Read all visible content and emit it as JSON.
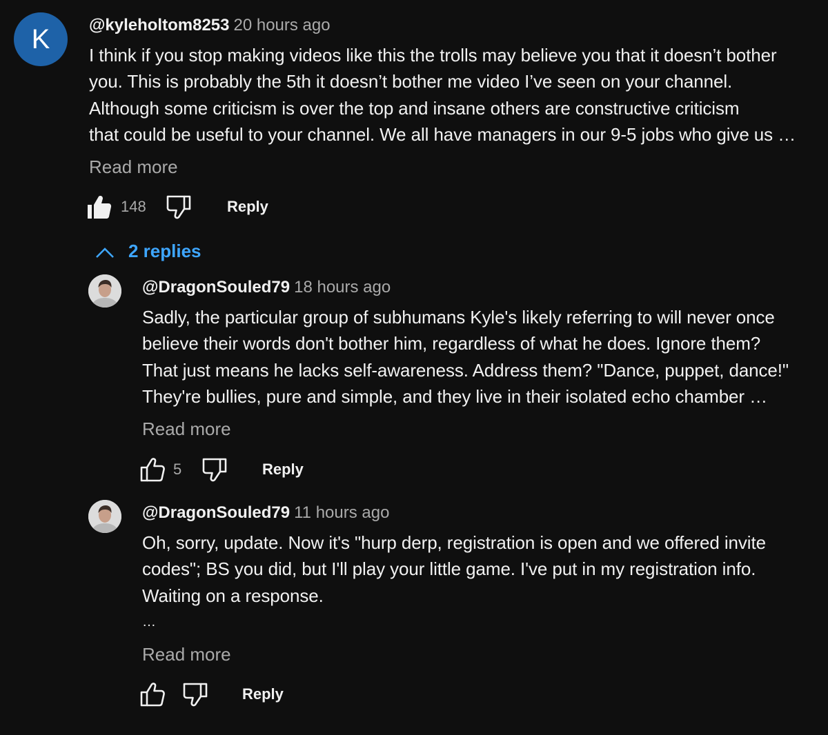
{
  "comments": [
    {
      "avatar_letter": "K",
      "avatar_color": "#1e62a8",
      "author": "@kyleholtom8253",
      "time": "20 hours ago",
      "body_lines": [
        "I think if you stop making videos like this the trolls may believe you that it doesn’t bother",
        "you. This is probably the 5th it doesn’t bother me video I’ve seen on your channel.",
        "Although some criticism is over the top and insane others are constructive criticism",
        "that could be useful to your channel. We all have managers in our 9-5 jobs who give us …"
      ],
      "read_more": "Read more",
      "like_count": "148",
      "liked": true,
      "reply_label": "Reply"
    }
  ],
  "replies_toggle": {
    "label": "2 replies",
    "icon": "chevron-up-icon",
    "color": "#3ea6ff"
  },
  "replies": [
    {
      "avatar": "profile-photo",
      "author": "@DragonSouled79",
      "time": "18 hours ago",
      "body_lines": [
        "Sadly, the particular group of subhumans Kyle's likely referring to will never once",
        "believe their words don't bother him, regardless of what he does. Ignore them?",
        "That just means he lacks self-awareness. Address them? \"Dance, puppet, dance!\"",
        "They're bullies, pure and simple, and they live in their isolated echo chamber …"
      ],
      "read_more": "Read more",
      "like_count": "5",
      "reply_label": "Reply"
    },
    {
      "avatar": "profile-photo",
      "author": "@DragonSouled79",
      "time": "11 hours ago",
      "body_lines": [
        "Oh, sorry, update. Now it's \"hurp derp, registration is open and we offered invite",
        "codes\"; BS you did, but I'll play your little game. I've put in my registration info.",
        "Waiting on a response.",
        "…"
      ],
      "read_more": "Read more",
      "like_count": "",
      "reply_label": "Reply"
    }
  ]
}
